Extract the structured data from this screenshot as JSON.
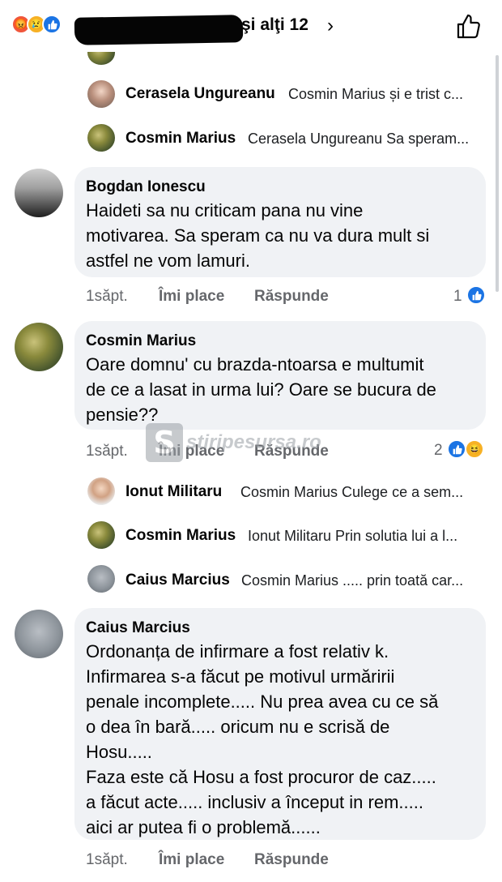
{
  "header": {
    "reactors_text": "şi alţi 12",
    "chevron": "›"
  },
  "replies_top": [
    {
      "name": "Cerasela Ungureanu",
      "text": "Cosmin Marius și e trist c..."
    },
    {
      "name": "Cosmin Marius",
      "text": "Cerasela Ungureanu Sa speram..."
    }
  ],
  "comments": [
    {
      "author": "Bogdan Ionescu",
      "text": "Haideti sa nu criticam pana nu vine\nmotivarea. Sa speram ca nu va dura mult si\nastfel ne vom lamuri.",
      "time": "1săpt.",
      "like_label": "Îmi place",
      "reply_label": "Răspunde",
      "reaction_count": "1"
    },
    {
      "author": "Cosmin Marius",
      "text": "Oare domnu' cu brazda-ntoarsa e multumit\nde ce a lasat in urma lui? Oare se bucura de\npensie??",
      "time": "1săpt.",
      "like_label": "Îmi place",
      "reply_label": "Răspunde",
      "reaction_count": "2"
    },
    {
      "author": "Caius Marcius",
      "text": "Ordonanța de infirmare a fost relativ k.\nInfirmarea s-a făcut pe motivul urmăririi\npenale incomplete..... Nu prea avea cu ce să\no dea în bară..... oricum nu e scrisă de\nHosu.....\nFaza este că Hosu a fost procuror de caz.....\na făcut acte..... inclusiv a început in rem.....\naici ar putea fi o problemă......",
      "time": "1săpt.",
      "like_label": "Îmi place",
      "reply_label": "Răspunde"
    }
  ],
  "replies_mid": [
    {
      "name": "Ionut Militaru",
      "text": "Cosmin Marius Culege ce a sem..."
    },
    {
      "name": "Cosmin Marius",
      "text": "Ionut Militaru Prin solutia lui a l..."
    },
    {
      "name": "Caius Marcius",
      "text": "Cosmin Marius ..... prin toată car..."
    }
  ],
  "watermark": {
    "logo_letter": "S",
    "text": "stiripesursa.ro"
  },
  "colors": {
    "like_blue": "#1b74e4",
    "bubble_bg": "#f0f2f5",
    "meta_gray": "#65676b"
  }
}
